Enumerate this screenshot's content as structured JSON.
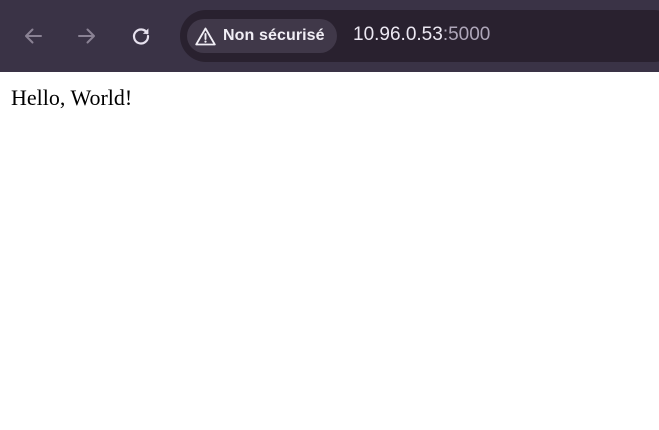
{
  "toolbar": {
    "background_color": "#3a3346",
    "back_button": {
      "icon": "arrow-left-icon",
      "enabled": false
    },
    "forward_button": {
      "icon": "arrow-right-icon",
      "enabled": false
    },
    "reload_button": {
      "icon": "reload-icon",
      "enabled": true
    }
  },
  "address_bar": {
    "security_chip": {
      "icon": "warning-triangle-icon",
      "label": "Non sécurisé"
    },
    "url_host": "10.96.0.53",
    "url_port": ":5000"
  },
  "page": {
    "text": "Hello, World!"
  }
}
